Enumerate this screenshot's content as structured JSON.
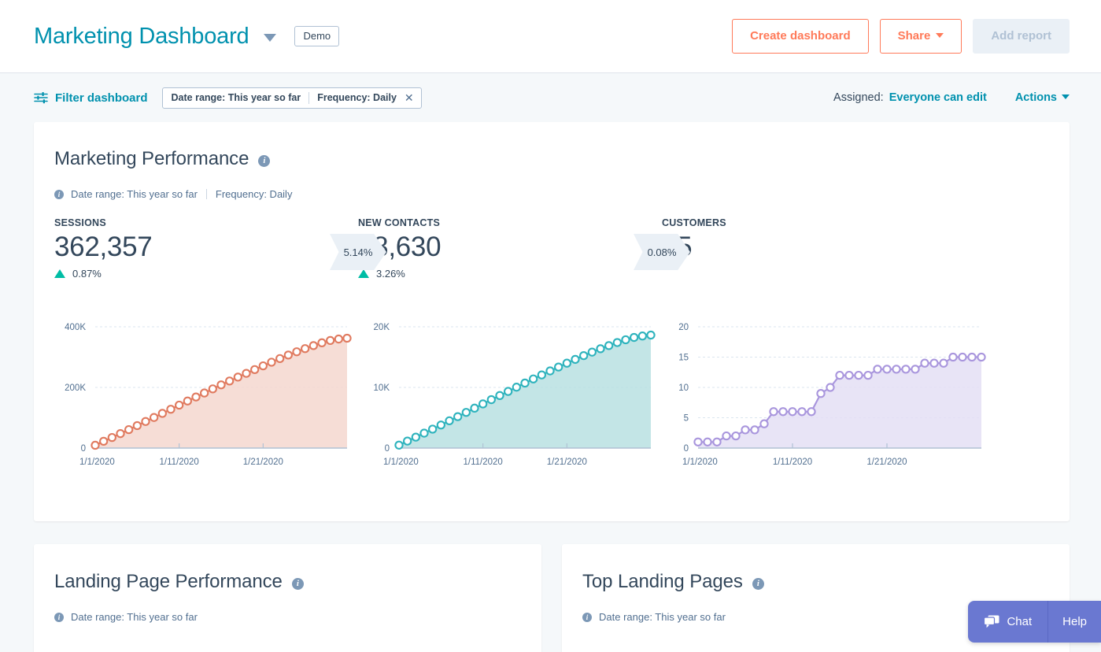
{
  "header": {
    "title": "Marketing Dashboard",
    "title_caret_icon": "chevron-down-icon",
    "badge": "Demo",
    "create_dashboard_label": "Create dashboard",
    "share_label": "Share",
    "add_report_label": "Add report"
  },
  "filterbar": {
    "filter_icon": "filter-sliders-icon",
    "filter_label": "Filter dashboard",
    "pill_date_range": "Date range: This year so far",
    "pill_frequency": "Frequency: Daily",
    "pill_close_icon": "close-icon",
    "assigned_label": "Assigned:",
    "assigned_value": "Everyone can edit",
    "actions_label": "Actions"
  },
  "marketing_performance": {
    "title": "Marketing Performance",
    "info_icon": "info-icon",
    "subtitle_date_range": "Date range: This year so far",
    "subtitle_frequency": "Frequency: Daily",
    "kpis": [
      {
        "label": "SESSIONS",
        "value": "362,357",
        "delta": "0.87%",
        "delta_direction": "up"
      },
      {
        "label": "NEW CONTACTS",
        "value": "18,630",
        "delta": "3.26%",
        "delta_direction": "up"
      },
      {
        "label": "CUSTOMERS",
        "value": "15",
        "delta": "",
        "delta_direction": "none"
      }
    ],
    "conversions": [
      {
        "value": "5.14%"
      },
      {
        "value": "0.08%"
      }
    ]
  },
  "landing_page_performance": {
    "title": "Landing Page Performance",
    "info_icon": "info-icon",
    "subtitle_date_range": "Date range: This year so far"
  },
  "top_landing_pages": {
    "title": "Top Landing Pages",
    "info_icon": "info-icon",
    "subtitle_date_range": "Date range: This year so far"
  },
  "chat_widget": {
    "chat_label": "Chat",
    "chat_icon": "chat-bubble-icon",
    "help_label": "Help"
  },
  "colors": {
    "brand_orange": "#ff7a59",
    "link_teal": "#0091ae",
    "text_navy": "#33475b",
    "page_bg": "#f5f8fa",
    "positive_green": "#00bda5",
    "sessions_series": "#e07a5f",
    "contacts_series": "#2eb3bd",
    "customers_series": "#a996dd",
    "chat_purple": "#6a78d1"
  },
  "chart_data": [
    {
      "type": "area",
      "name": "sessions-chart",
      "title": "SESSIONS",
      "color": "#e07a5f",
      "fill": "#f4d7cf",
      "xlabel": "",
      "ylabel": "",
      "ylim": [
        0,
        400000
      ],
      "yticks": [
        0,
        200000,
        400000
      ],
      "ytick_labels": [
        "0",
        "200K",
        "400K"
      ],
      "grid": true,
      "xticks": [
        "1/1/2020",
        "1/11/2020",
        "1/21/2020"
      ],
      "x": [
        "1/1/2020",
        "1/2/2020",
        "1/3/2020",
        "1/4/2020",
        "1/5/2020",
        "1/6/2020",
        "1/7/2020",
        "1/8/2020",
        "1/9/2020",
        "1/10/2020",
        "1/11/2020",
        "1/12/2020",
        "1/13/2020",
        "1/14/2020",
        "1/15/2020",
        "1/16/2020",
        "1/17/2020",
        "1/18/2020",
        "1/19/2020",
        "1/20/2020",
        "1/21/2020",
        "1/22/2020",
        "1/23/2020",
        "1/24/2020",
        "1/25/2020",
        "1/26/2020",
        "1/27/2020",
        "1/28/2020",
        "1/29/2020",
        "1/30/2020",
        "1/31/2020"
      ],
      "values": [
        9200,
        22400,
        34800,
        47600,
        60800,
        74000,
        87600,
        100800,
        114400,
        128000,
        141600,
        155200,
        168400,
        181600,
        195200,
        208400,
        221200,
        234000,
        246400,
        258800,
        271200,
        283200,
        295200,
        306800,
        317600,
        328000,
        338000,
        347200,
        354800,
        359600,
        362357
      ]
    },
    {
      "type": "area",
      "name": "new-contacts-chart",
      "title": "NEW CONTACTS",
      "color": "#2eb3bd",
      "fill": "#b9e0e2",
      "xlabel": "",
      "ylabel": "",
      "ylim": [
        0,
        20000
      ],
      "yticks": [
        0,
        10000,
        20000
      ],
      "ytick_labels": [
        "0",
        "10K",
        "20K"
      ],
      "grid": true,
      "xticks": [
        "1/1/2020",
        "1/11/2020",
        "1/21/2020"
      ],
      "x": [
        "1/1/2020",
        "1/2/2020",
        "1/3/2020",
        "1/4/2020",
        "1/5/2020",
        "1/6/2020",
        "1/7/2020",
        "1/8/2020",
        "1/9/2020",
        "1/10/2020",
        "1/11/2020",
        "1/12/2020",
        "1/13/2020",
        "1/14/2020",
        "1/15/2020",
        "1/16/2020",
        "1/17/2020",
        "1/18/2020",
        "1/19/2020",
        "1/20/2020",
        "1/21/2020",
        "1/22/2020",
        "1/23/2020",
        "1/24/2020",
        "1/25/2020",
        "1/26/2020",
        "1/27/2020",
        "1/28/2020",
        "1/29/2020",
        "1/30/2020",
        "1/31/2020"
      ],
      "values": [
        480,
        1150,
        1800,
        2460,
        3120,
        3800,
        4500,
        5180,
        5880,
        6580,
        7280,
        7980,
        8660,
        9340,
        10040,
        10720,
        11400,
        12060,
        12720,
        13360,
        14000,
        14620,
        15240,
        15820,
        16380,
        16900,
        17400,
        17860,
        18240,
        18480,
        18630
      ]
    },
    {
      "type": "area",
      "name": "customers-chart",
      "title": "CUSTOMERS",
      "color": "#a996dd",
      "fill": "#e4dff4",
      "xlabel": "",
      "ylabel": "",
      "ylim": [
        0,
        20
      ],
      "yticks": [
        0,
        5,
        10,
        15,
        20
      ],
      "ytick_labels": [
        "0",
        "5",
        "10",
        "15",
        "20"
      ],
      "grid": true,
      "xticks": [
        "1/1/2020",
        "1/11/2020",
        "1/21/2020"
      ],
      "x": [
        "1/1/2020",
        "1/2/2020",
        "1/3/2020",
        "1/4/2020",
        "1/5/2020",
        "1/6/2020",
        "1/7/2020",
        "1/8/2020",
        "1/9/2020",
        "1/10/2020",
        "1/11/2020",
        "1/12/2020",
        "1/13/2020",
        "1/14/2020",
        "1/15/2020",
        "1/16/2020",
        "1/17/2020",
        "1/18/2020",
        "1/19/2020",
        "1/20/2020",
        "1/21/2020",
        "1/22/2020",
        "1/23/2020",
        "1/24/2020",
        "1/25/2020",
        "1/26/2020",
        "1/27/2020",
        "1/28/2020",
        "1/29/2020",
        "1/30/2020",
        "1/31/2020"
      ],
      "values": [
        1,
        1,
        1,
        2,
        2,
        3,
        3,
        4,
        6,
        6,
        6,
        6,
        6,
        9,
        10,
        12,
        12,
        12,
        12,
        13,
        13,
        13,
        13,
        13,
        14,
        14,
        14,
        15,
        15,
        15,
        15
      ]
    }
  ]
}
